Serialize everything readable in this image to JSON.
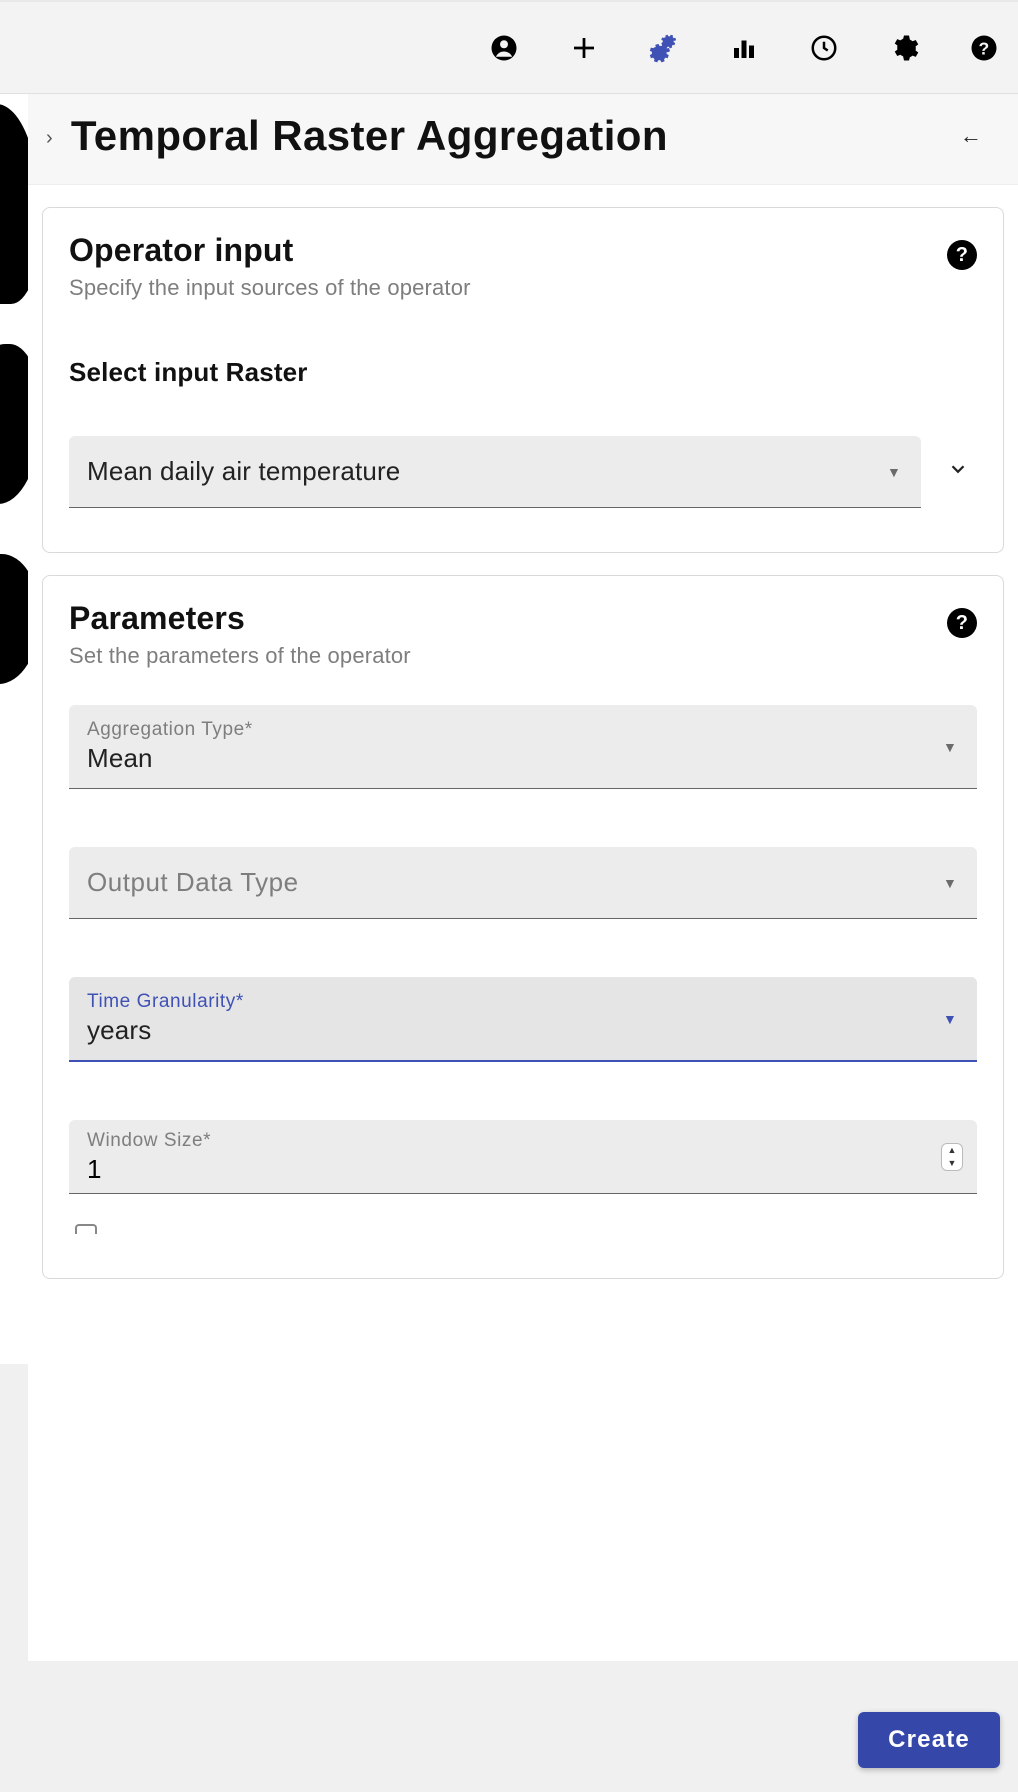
{
  "toolbar": {
    "icons": {
      "account": "account-icon",
      "add": "add-icon",
      "processing": "gears-icon",
      "stats": "bar-chart-icon",
      "history": "clock-icon",
      "settings": "gear-icon",
      "help": "help-icon"
    }
  },
  "header": {
    "breadcrumb_chevron": "›",
    "title": "Temporal Raster Aggregation",
    "back_arrow": "←"
  },
  "card_input": {
    "title": "Operator input",
    "subtitle": "Specify the input sources of the operator",
    "section_label": "Select input Raster",
    "raster_value": "Mean daily air temperature",
    "help_badge": "?"
  },
  "card_params": {
    "title": "Parameters",
    "subtitle": "Set the parameters of the operator",
    "help_badge": "?",
    "fields": {
      "aggregation_type": {
        "label": "Aggregation Type*",
        "value": "Mean"
      },
      "output_data_type": {
        "placeholder": "Output Data Type"
      },
      "time_granularity": {
        "label": "Time Granularity*",
        "value": "years"
      },
      "window_size": {
        "label": "Window Size*",
        "value": "1"
      }
    }
  },
  "create_button": "Create"
}
